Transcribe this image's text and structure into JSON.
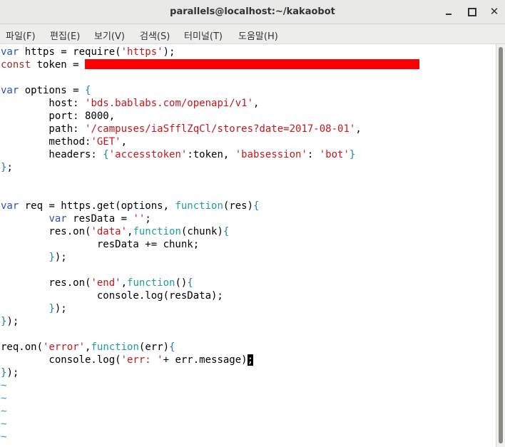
{
  "window": {
    "title": "parallels@localhost:~/kakaobot",
    "minimize_glyph": "",
    "maximize_glyph": "",
    "close_glyph": "✕"
  },
  "menu": {
    "items": [
      {
        "label": "파일(F)"
      },
      {
        "label": "편집(E)"
      },
      {
        "label": "보기(V)"
      },
      {
        "label": "검색(S)"
      },
      {
        "label": "터미널(T)"
      },
      {
        "label": "도움말(H)"
      }
    ]
  },
  "code": {
    "l1": [
      "var",
      " https = require(",
      "'https'",
      ");"
    ],
    "l2": [
      "const",
      " token = "
    ],
    "l3": [],
    "l4": [
      "var",
      " options = ",
      "{"
    ],
    "l5": [
      "        host: ",
      "'bds.bablabs.com/openapi/v1'",
      ","
    ],
    "l6": [
      "        port: 8000,"
    ],
    "l7": [
      "        path: ",
      "'/campuses/iaSfflZqCl/stores?date=2017-08-01'",
      ","
    ],
    "l8": [
      "        method:",
      "'GET'",
      ","
    ],
    "l9": [
      "        headers: ",
      "{",
      "'accesstoken'",
      ":token, ",
      "'babsession'",
      ": ",
      "'bot'",
      "}"
    ],
    "l10": [
      "}",
      ";"
    ],
    "l11": [],
    "l12": [],
    "l13": [
      "var",
      " req = https.get(options, ",
      "function",
      "(res)",
      "{"
    ],
    "l14": [
      "        ",
      "var",
      " resData = ",
      "''",
      ";"
    ],
    "l15": [
      "        res.on(",
      "'data'",
      ",",
      "function",
      "(chunk)",
      "{"
    ],
    "l16": [
      "                resData += chunk;"
    ],
    "l17": [
      "        ",
      "}",
      ");"
    ],
    "l18": [],
    "l19": [
      "        res.on(",
      "'end'",
      ",",
      "function",
      "()",
      "{"
    ],
    "l20": [
      "                console.log(resData);"
    ],
    "l21": [
      "        ",
      "}",
      ");"
    ],
    "l22": [
      "}",
      ");"
    ],
    "l23": [],
    "l24": [
      "req.on(",
      "'error'",
      ",",
      "function",
      "(err)",
      "{"
    ],
    "l25": [
      "        console.log(",
      "'err: '",
      "+ err.message)",
      ";"
    ],
    "l26": [
      "}",
      ");"
    ],
    "tilde": "~"
  },
  "colors": {
    "keyword": "#2a52be",
    "const_keyword": "#a52a2a",
    "string": "#c4161c",
    "function_keyword": "#1d9d9d",
    "bracket": "#1d7fae",
    "redaction": "#ff0000"
  }
}
